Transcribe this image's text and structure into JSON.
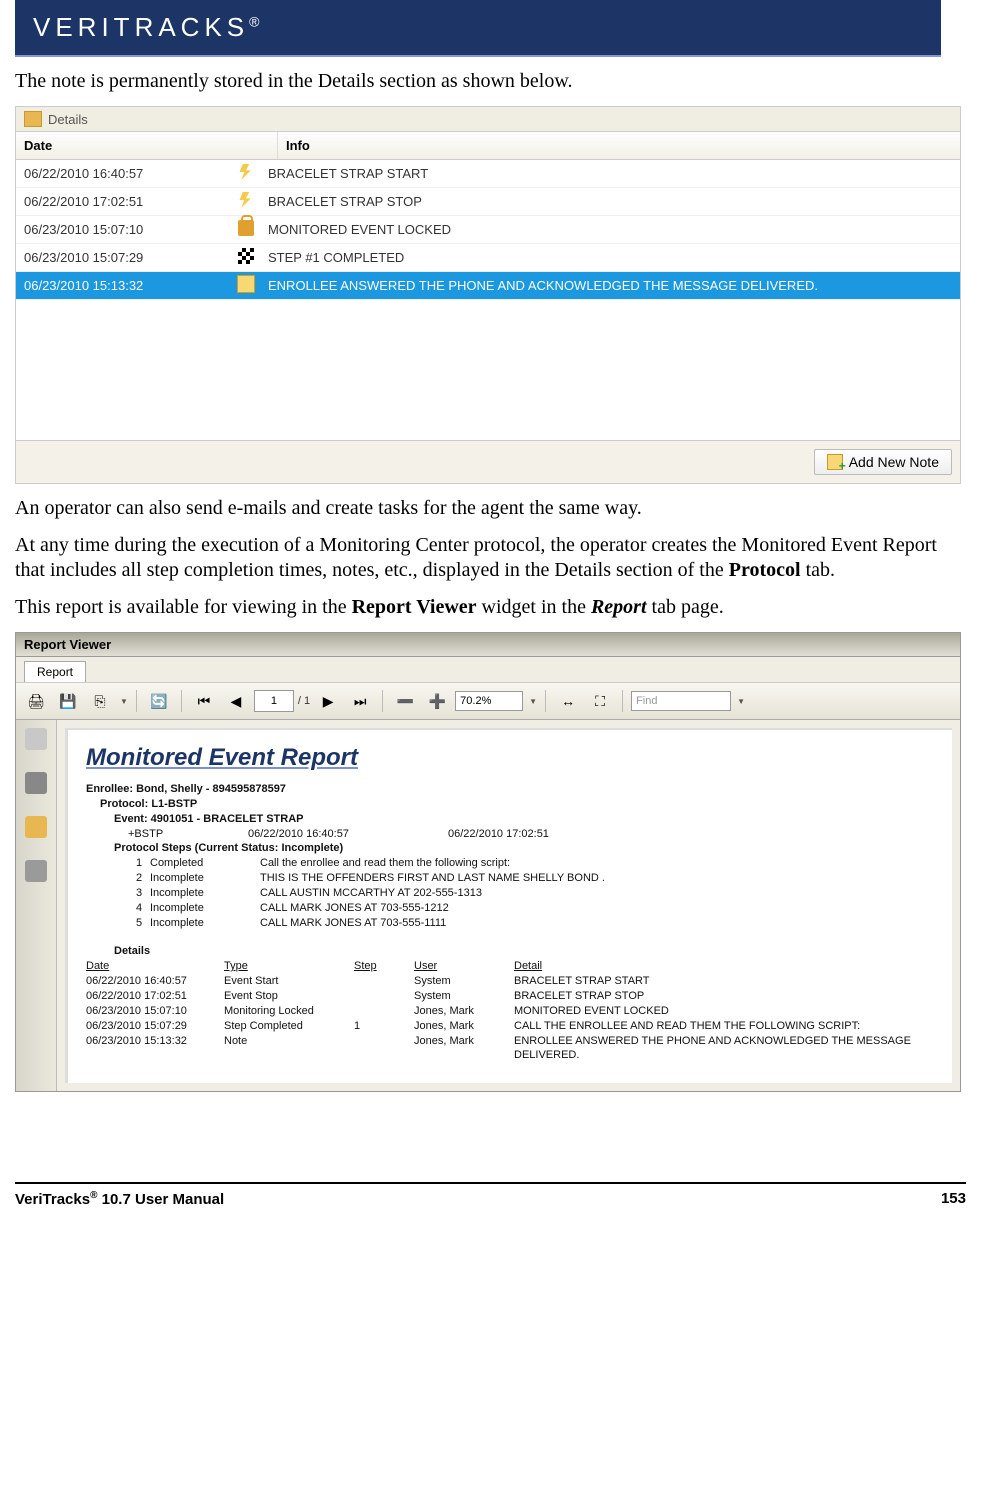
{
  "logo_text": "VERITRACKS",
  "para1": "The note is permanently stored in the Details section as shown below.",
  "details": {
    "title": "Details",
    "columns": {
      "date": "Date",
      "info": "Info"
    },
    "rows": [
      {
        "date": "06/22/2010 16:40:57",
        "icon": "lightning",
        "info": "BRACELET STRAP START",
        "selected": false
      },
      {
        "date": "06/22/2010 17:02:51",
        "icon": "lightning",
        "info": "BRACELET STRAP STOP",
        "selected": false
      },
      {
        "date": "06/23/2010 15:07:10",
        "icon": "lock",
        "info": "MONITORED EVENT LOCKED",
        "selected": false
      },
      {
        "date": "06/23/2010 15:07:29",
        "icon": "flag",
        "info": "STEP #1 COMPLETED",
        "selected": false
      },
      {
        "date": "06/23/2010 15:13:32",
        "icon": "note",
        "info": "ENROLLEE ANSWERED THE PHONE AND ACKNOWLEDGED THE MESSAGE DELIVERED.",
        "selected": true
      }
    ],
    "add_note_label": "Add New Note"
  },
  "para2": "An operator can also send e-mails and create tasks for the agent the same way.",
  "para3_pre": "At any time during the execution of a Monitoring Center protocol, the operator creates the Monitored Event Report that includes all step completion times, notes, etc., displayed in the Details section of the ",
  "para3_bold": "Protocol",
  "para3_post": " tab.",
  "para4_pre": "This report is available for viewing in the ",
  "para4_b1": "Report Viewer",
  "para4_mid": " widget in the ",
  "para4_b2": "Report",
  "para4_post": " tab page.",
  "report": {
    "title": "Report Viewer",
    "tab_label": "Report",
    "toolbar": {
      "page_current": "1",
      "page_sep": "/ 1",
      "zoom_value": "70.2%",
      "find_placeholder": "Find"
    },
    "heading": "Monitored Event Report",
    "enrollee": "Enrollee: Bond, Shelly - 894595878597",
    "protocol": "Protocol: L1-BSTP",
    "event": "Event: 4901051 - BRACELET STRAP",
    "bstp": "+BSTP",
    "bstp_t1": "06/22/2010  16:40:57",
    "bstp_t2": "06/22/2010  17:02:51",
    "steps_header": "Protocol Steps (Current Status: Incomplete)",
    "steps": [
      {
        "n": "1",
        "status": "Completed",
        "desc": "Call the enrollee and read them the following script:"
      },
      {
        "n": "2",
        "status": "Incomplete",
        "desc": "THIS IS THE OFFENDERS FIRST AND LAST NAME SHELLY BOND ."
      },
      {
        "n": "3",
        "status": "Incomplete",
        "desc": "CALL AUSTIN MCCARTHY AT 202-555-1313"
      },
      {
        "n": "4",
        "status": "Incomplete",
        "desc": "CALL MARK JONES AT 703-555-1212"
      },
      {
        "n": "5",
        "status": "Incomplete",
        "desc": "CALL MARK JONES AT 703-555-1111"
      }
    ],
    "details_label": "Details",
    "dcols": {
      "date": "Date",
      "type": "Type",
      "step": "Step",
      "user": "User",
      "detail": "Detail"
    },
    "drows": [
      {
        "date": "06/22/2010  16:40:57",
        "type": "Event Start",
        "step": "",
        "user": "System",
        "detail": "BRACELET STRAP START"
      },
      {
        "date": "06/22/2010  17:02:51",
        "type": "Event Stop",
        "step": "",
        "user": "System",
        "detail": "BRACELET STRAP STOP"
      },
      {
        "date": "06/23/2010  15:07:10",
        "type": "Monitoring Locked",
        "step": "",
        "user": "Jones, Mark",
        "detail": "MONITORED EVENT LOCKED"
      },
      {
        "date": "06/23/2010  15:07:29",
        "type": "Step Completed",
        "step": "1",
        "user": "Jones, Mark",
        "detail": "CALL THE ENROLLEE AND READ THEM THE FOLLOWING SCRIPT:"
      },
      {
        "date": "06/23/2010  15:13:32",
        "type": "Note",
        "step": "",
        "user": "Jones, Mark",
        "detail": "ENROLLEE ANSWERED THE PHONE AND ACKNOWLEDGED THE MESSAGE DELIVERED."
      }
    ]
  },
  "footer": {
    "left_pre": "VeriTracks",
    "left_post": " 10.7 User Manual",
    "right": "153"
  }
}
